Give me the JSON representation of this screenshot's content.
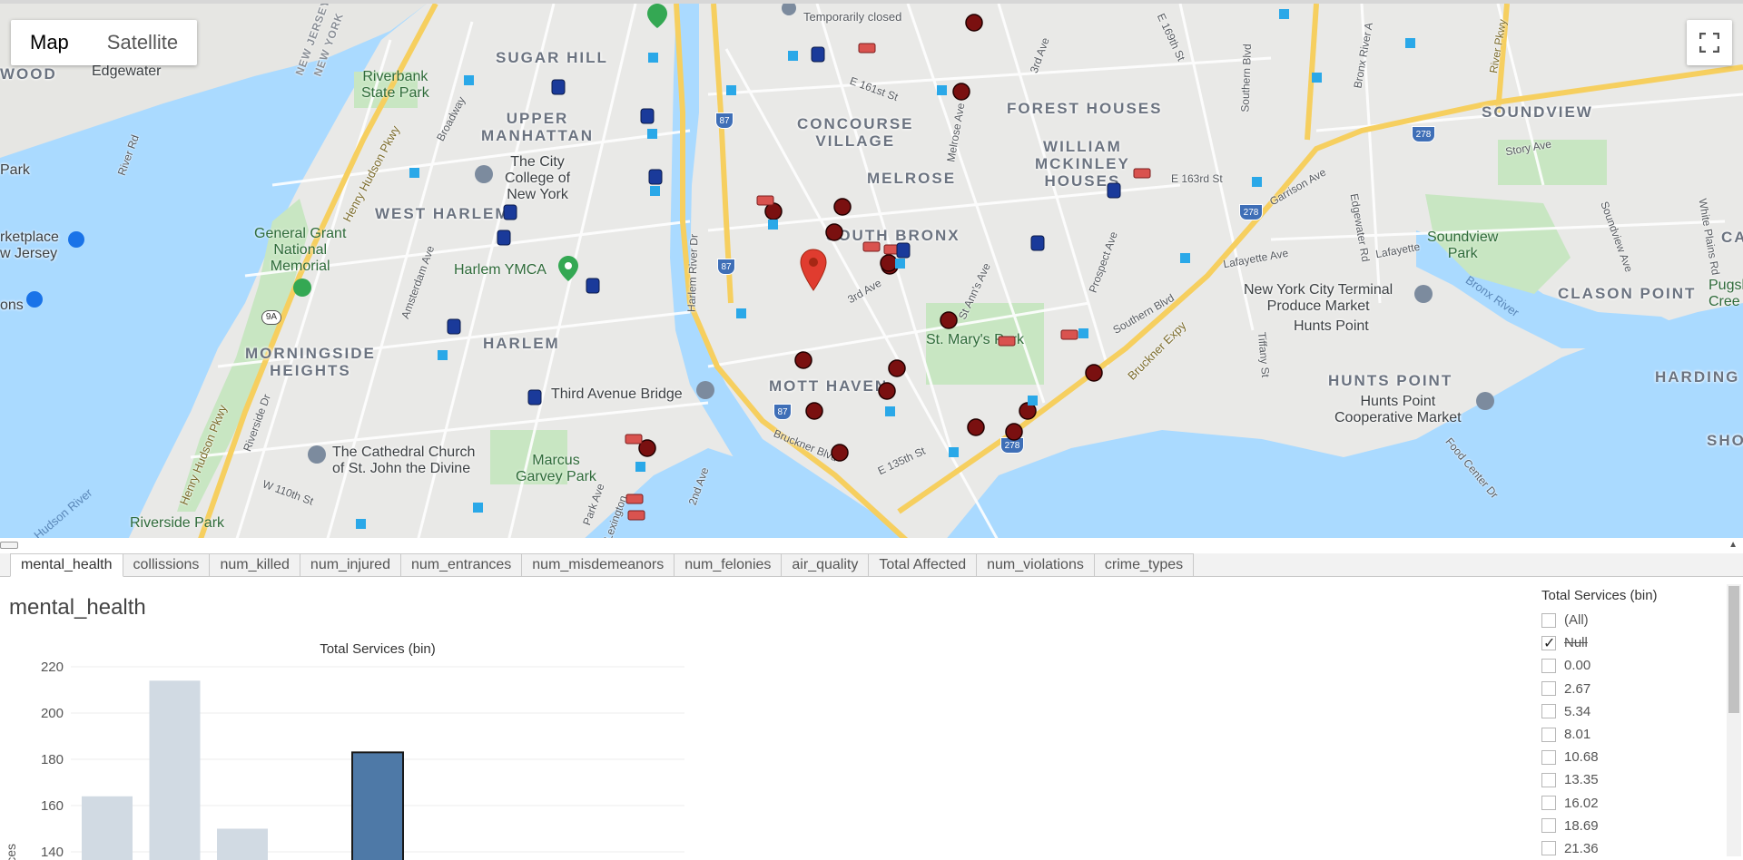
{
  "map": {
    "toggle": {
      "map": "Map",
      "satellite": "Satellite"
    },
    "neighborhoods": {
      "sugar_hill": "SUGAR HILL",
      "upper_manhattan": "UPPER\nMANHATTAN",
      "west_harlem": "WEST HARLEM",
      "harlem": "HARLEM",
      "morningside": "MORNINGSIDE\nHEIGHTS",
      "concourse": "CONCOURSE\nVILLAGE",
      "melrose": "MELROSE",
      "south_bronx": "SOUTH BRONX",
      "mott_haven": "MOTT HAVEN",
      "forest_houses": "FOREST HOUSES",
      "william": "WILLIAM\nMCKINLEY\nHOUSES",
      "soundview": "SOUNDVIEW",
      "clason_point": "CLASON POINT",
      "hunts_point": "HUNTS POINT",
      "harding": "HARDING",
      "wood": "WOOD",
      "new_jersey": "NEW JERSEY",
      "new_york": "NEW YORK"
    },
    "pois": {
      "edgewater": "Edgewater",
      "riverbank": "Riverbank\nState Park",
      "city_college": "The City\nCollege of\nNew York",
      "grant": "General Grant\nNational\nMemorial",
      "ymca": "Harlem YMCA",
      "third_ave_bridge": "Third Avenue Bridge",
      "cathedral": "The Cathedral Church\nof St. John the Divine",
      "marcus": "Marcus\nGarvey Park",
      "riverside_park": "Riverside Park",
      "st_marys": "St. Mary's Park",
      "nycterminal": "New York City Terminal\nProduce Market",
      "hunts_point_lbl": "Hunts Point",
      "hp_coop": "Hunts Point\nCooperative Market",
      "soundview_park": "Soundview\nPark",
      "temporarily_closed": "Temporarily closed",
      "park": "Park",
      "marketplace": "rketplace\nw Jersey",
      "ons": "ons",
      "ca": "CA",
      "creek": "Pugsley\nCree",
      "sho": "SHO"
    },
    "streets": {
      "henry_hudson": "Henry Hudson Pkwy",
      "henry_hudson2": "Henry Hudson Pkwy",
      "broadway": "Broadway",
      "amsterdam": "Amsterdam Ave",
      "riverside_dr": "Riverside Dr",
      "w110": "W 110th St",
      "harlem_river_dr": "Harlem River Dr",
      "park_ave": "Park Ave",
      "lexington": "Lexington",
      "second_ave": "2nd Ave",
      "third_ave": "3rd Ave",
      "melrose_ave": "Melrose Ave",
      "e161": "E 161st St",
      "e163": "E 163rd St",
      "e169": "E 169th St",
      "bruckner_blvd": "Bruckner Blvd",
      "e135": "E 135th St",
      "bruckner_expy": "Bruckner Expy",
      "southern_blvd": "Southern Blvd",
      "southern_blvd2": "Southern Blvd",
      "prospect": "Prospect Ave",
      "st_anns": "St Ann's Ave",
      "garrison": "Garrison Ave",
      "lafayette": "Lafayette Ave",
      "lafayette2": "Lafayette",
      "edgewater_rd": "Edgewater Rd",
      "tiffany": "Tiffany St",
      "story": "Story Ave",
      "soundview_ave": "Soundview Ave",
      "white_plains": "White Plains Rd",
      "river_pkwy": "River Pkwy",
      "bronx_river": "Bronx River",
      "food_center": "Food Center Dr",
      "river_rd": "River Rd",
      "hudson_river": "Hudson River",
      "bronx_river_ave": "Bronx River A",
      "third_ave_n": "3rd Ave",
      "route_87": "87",
      "route_278": "278",
      "route_9a": "9A"
    }
  },
  "tabs": [
    "mental_health",
    "collissions",
    "num_killed",
    "num_injured",
    "num_entrances",
    "num_misdemeanors",
    "num_felonies",
    "air_quality",
    "Total Affected",
    "num_violations",
    "crime_types"
  ],
  "sheet": {
    "title": "mental_health"
  },
  "chart_data": {
    "type": "bar",
    "title": "Total Services (bin)",
    "ylabel": "Services",
    "ylim": [
      140,
      220
    ],
    "yticks": [
      "220",
      "200",
      "180",
      "160",
      "140"
    ],
    "values": [
      164,
      214,
      150,
      null,
      183
    ],
    "highlighted_index": 4,
    "colors": {
      "bar": "#d1dae3",
      "highlight": "#4e79a7",
      "highlight_stroke": "#1a1a1a"
    }
  },
  "legend": {
    "title": "Total Services (bin)",
    "items": [
      {
        "label": "(All)",
        "checked": false,
        "strike": false
      },
      {
        "label": "Null",
        "checked": true,
        "strike": true
      },
      {
        "label": "0.00",
        "checked": false,
        "strike": false
      },
      {
        "label": "2.67",
        "checked": false,
        "strike": false
      },
      {
        "label": "5.34",
        "checked": false,
        "strike": false
      },
      {
        "label": "8.01",
        "checked": false,
        "strike": false
      },
      {
        "label": "10.68",
        "checked": false,
        "strike": false
      },
      {
        "label": "13.35",
        "checked": false,
        "strike": false
      },
      {
        "label": "16.02",
        "checked": false,
        "strike": false
      },
      {
        "label": "18.69",
        "checked": false,
        "strike": false
      },
      {
        "label": "21.36",
        "checked": false,
        "strike": false
      }
    ]
  },
  "colors": {
    "water": "#aadaff",
    "land": "#e8e8e6",
    "park": "#c8e6c2",
    "highway": "#f6d26b",
    "marker_red": "#e03c2f"
  }
}
